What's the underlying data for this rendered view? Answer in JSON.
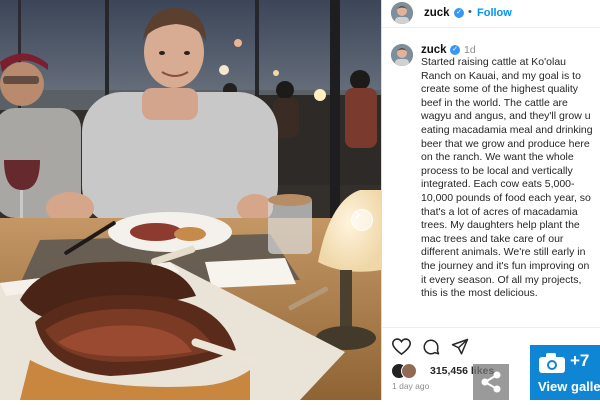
{
  "post": {
    "username": "zuck",
    "follow_label": "Follow",
    "separator": "•",
    "age": "1d",
    "caption": "Started raising cattle at Ko'olau\nRanch on Kauai, and my goal is to\ncreate some of the highest quality\nbeef in the world. The cattle are\nwagyu and angus, and they'll grow u\neating macadamia meal and drinking\nbeer that we grow and produce here\non the ranch. We want the whole\nprocess to be local and vertically\nintegrated. Each cow eats 5,000-\n10,000 pounds of food each year, so\nthat's a lot of acres of macadamia\ntrees. My daughters help plant the\nmac trees and take care of our\ndifferent animals. We're still early in\nthe journey and it's fun improving on\nit every season. Of all my projects,\nthis is the most delicious.",
    "likes": "315,456 likes",
    "time_ago": "1 day ago"
  },
  "gallery": {
    "count": "+7",
    "label": "View gallery"
  },
  "icons": {
    "like": "heart-icon",
    "comment": "comment-icon",
    "share": "send-icon",
    "verified": "verified-badge-icon",
    "camera": "camera-icon",
    "carousel": "chevron-right-icon"
  },
  "colors": {
    "follow": "#0095f6",
    "verified": "#3897f0",
    "gallery": "#0f86d4",
    "caption_text": "#262626",
    "muted": "#8e8e8e"
  }
}
